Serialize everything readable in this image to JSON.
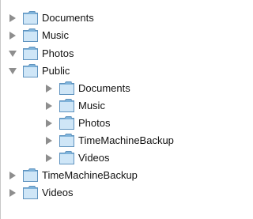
{
  "colors": {
    "disclosure": "#8e8e8e",
    "folder_light": "#cfe6f7",
    "folder_dark": "#7fb3da",
    "folder_outline": "#5f93bf",
    "border": "#c8c8c8"
  },
  "tree": {
    "items": [
      {
        "label": "Documents",
        "depth": 0,
        "expanded": false,
        "icon": "folder-icon"
      },
      {
        "label": "Music",
        "depth": 0,
        "expanded": false,
        "icon": "folder-icon"
      },
      {
        "label": "Photos",
        "depth": 0,
        "expanded": true,
        "icon": "folder-icon"
      },
      {
        "label": "Public",
        "depth": 0,
        "expanded": true,
        "icon": "folder-icon"
      },
      {
        "label": "Documents",
        "depth": 1,
        "expanded": false,
        "icon": "folder-icon"
      },
      {
        "label": "Music",
        "depth": 1,
        "expanded": false,
        "icon": "folder-icon"
      },
      {
        "label": "Photos",
        "depth": 1,
        "expanded": false,
        "icon": "folder-icon"
      },
      {
        "label": "TimeMachineBackup",
        "depth": 1,
        "expanded": false,
        "icon": "folder-icon"
      },
      {
        "label": "Videos",
        "depth": 1,
        "expanded": false,
        "icon": "folder-icon"
      },
      {
        "label": "TimeMachineBackup",
        "depth": 0,
        "expanded": false,
        "icon": "folder-icon"
      },
      {
        "label": "Videos",
        "depth": 0,
        "expanded": false,
        "icon": "folder-icon"
      }
    ]
  }
}
